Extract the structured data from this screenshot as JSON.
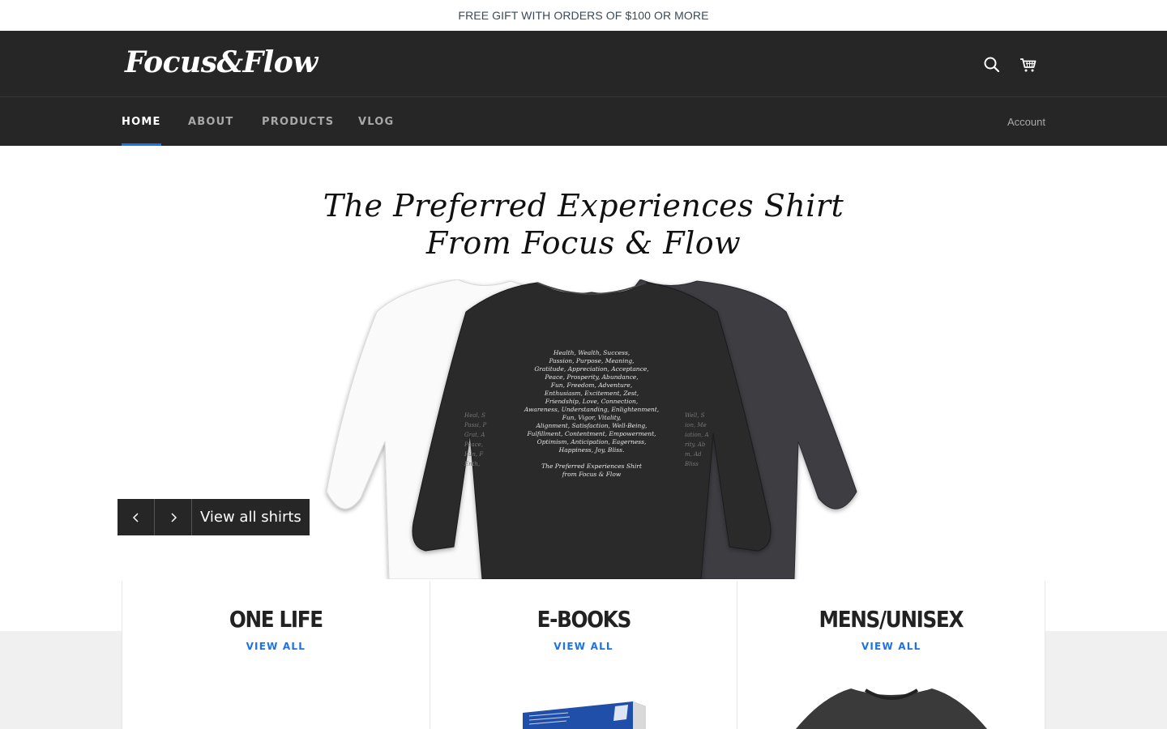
{
  "announcement": {
    "text": "FREE GIFT WITH ORDERS OF $100 OR MORE"
  },
  "header": {
    "logo_text": "Focus&Flow",
    "icons": [
      "search-icon",
      "cart-icon"
    ]
  },
  "nav": {
    "items": [
      {
        "label": "HOME",
        "active": true
      },
      {
        "label": "ABOUT",
        "active": false
      },
      {
        "label": "PRODUCTS",
        "active": false
      },
      {
        "label": "VLOG",
        "active": false
      }
    ],
    "account_label": "Account"
  },
  "hero": {
    "title_line1": "The Preferred Experiences Shirt",
    "title_line2": "From Focus & Flow",
    "shirt_text": [
      "Health, Wealth, Success,",
      "Passion, Purpose, Meaning,",
      "Gratitude, Appreciation, Acceptance,",
      "Peace, Prosperity, Abundance,",
      "Fun, Freedom, Adventure,",
      "Enthusiasm, Excitement, Zest,",
      "Friendship, Love, Connection,",
      "Awareness, Understanding, Enlightenment,",
      "Fun, Vigor, Vitality,",
      "Alignment, Satisfaction, Well-Being,",
      "Fulfillment, Contentment, Empowerment,",
      "Optimism, Anticipation, Eagerness,",
      "Happiness, Joy, Bliss."
    ],
    "shirt_footer_line1": "The Preferred Experiences Shirt",
    "shirt_footer_line2": "from Focus & Flow",
    "prev_icon": "chevron-left-icon",
    "next_icon": "chevron-right-icon",
    "cta_label": "View all shirts"
  },
  "collections": [
    {
      "title": "ONE LIFE",
      "link": "VIEW ALL"
    },
    {
      "title": "E-BOOKS",
      "link": "VIEW ALL"
    },
    {
      "title": "MENS/UNISEX",
      "link": "VIEW ALL"
    }
  ],
  "colors": {
    "header_bg": "#262626",
    "accent": "#1a73e8",
    "announcement_text": "#3a4a5a",
    "collections_bg": "#f0f0f0"
  }
}
